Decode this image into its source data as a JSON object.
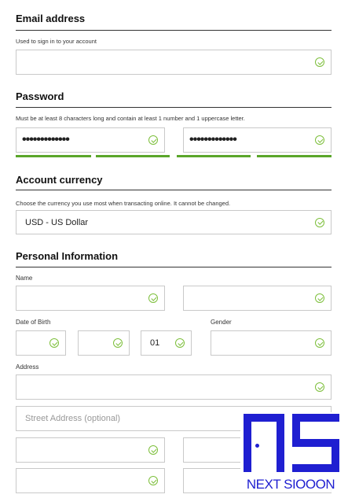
{
  "email": {
    "heading": "Email address",
    "hint": "Used to sign in to your account",
    "value": ""
  },
  "password": {
    "heading": "Password",
    "hint": "Must be at least 8 characters long and contain at least 1 number and 1 uppercase letter.",
    "value": "•••••••••••••",
    "confirm_value": "•••••••••••••",
    "strength_segments_filled": 4,
    "strength_segments_total": 4
  },
  "currency": {
    "heading": "Account currency",
    "hint": "Choose the currency you use most when transacting online. It cannot be changed.",
    "value": "USD - US Dollar"
  },
  "personal": {
    "heading": "Personal Information",
    "name_label": "Name",
    "dob_label": "Date of Birth",
    "dob_year": "01",
    "gender_label": "Gender",
    "address_label": "Address",
    "street_placeholder": "Street Address (optional)"
  },
  "watermark": {
    "text": "NEXT SIOOON",
    "color": "#1f1fd1"
  },
  "colors": {
    "valid": "#7dbf3b",
    "strength": "#5aa62a"
  }
}
